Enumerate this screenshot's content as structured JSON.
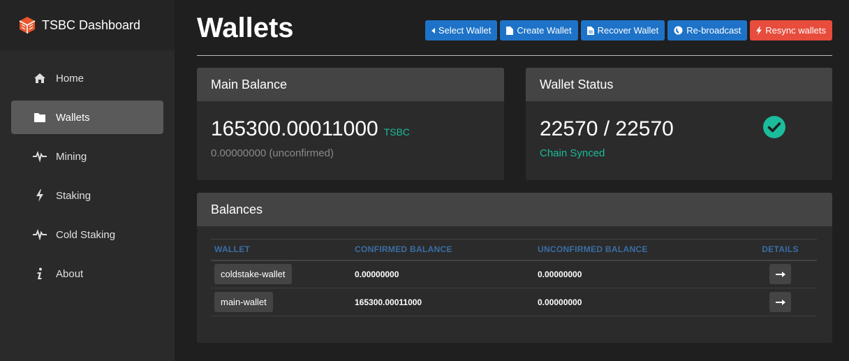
{
  "brand": {
    "title": "TSBC Dashboard",
    "icon": "cube-logo-icon",
    "color": "#e8552b"
  },
  "sidebar": {
    "items": [
      {
        "label": "Home",
        "icon": "home-icon"
      },
      {
        "label": "Wallets",
        "icon": "folder-icon",
        "active": true
      },
      {
        "label": "Mining",
        "icon": "pulse-icon"
      },
      {
        "label": "Staking",
        "icon": "bolt-icon"
      },
      {
        "label": "Cold Staking",
        "icon": "pulse-icon"
      },
      {
        "label": "About",
        "icon": "info-icon"
      }
    ]
  },
  "page": {
    "title": "Wallets"
  },
  "toolbar": {
    "select_wallet": "Select Wallet",
    "create_wallet": "Create Wallet",
    "recover_wallet": "Recover Wallet",
    "rebroadcast": "Re-broadcast",
    "resync_wallets": "Resync wallets"
  },
  "main_balance": {
    "header": "Main Balance",
    "value": "165300.00011000",
    "unit": "TSBC",
    "unconfirmed": "0.00000000 (unconfirmed)"
  },
  "wallet_status": {
    "header": "Wallet Status",
    "value": "22570 / 22570",
    "status": "Chain Synced"
  },
  "balances": {
    "header": "Balances",
    "columns": [
      "WALLET",
      "CONFIRMED BALANCE",
      "UNCONFIRMED BALANCE",
      "DETAILS"
    ],
    "rows": [
      {
        "wallet": "coldstake-wallet",
        "confirmed": "0.00000000",
        "unconfirmed": "0.00000000"
      },
      {
        "wallet": "main-wallet",
        "confirmed": "165300.00011000",
        "unconfirmed": "0.00000000"
      }
    ]
  },
  "colors": {
    "accent_blue": "#1e73c8",
    "danger_red": "#e74c3c",
    "success_green": "#1abc9c",
    "column_header_blue": "#3a6ea5"
  }
}
